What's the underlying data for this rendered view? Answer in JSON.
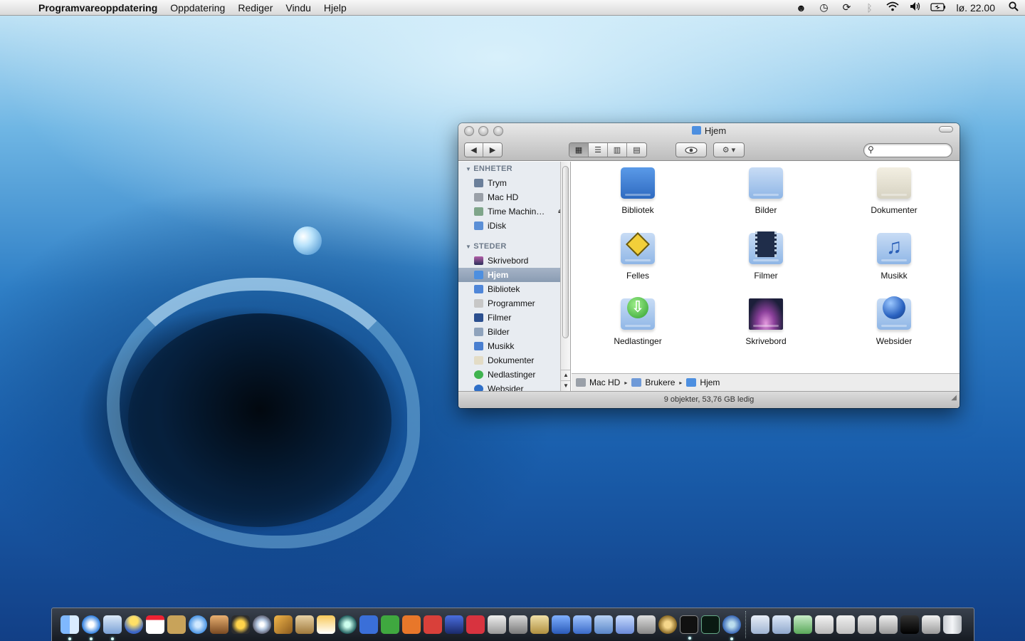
{
  "menubar": {
    "app_name": "Programvareoppdatering",
    "menus": [
      "Oppdatering",
      "Rediger",
      "Vindu",
      "Hjelp"
    ],
    "clock": "lø. 22.00"
  },
  "window": {
    "title": "Hjem",
    "search_placeholder": "",
    "sidebar": {
      "devices_heading": "ENHETER",
      "devices": [
        "Trym",
        "Mac HD",
        "Time Machin…",
        "iDisk"
      ],
      "places_heading": "STEDER",
      "places": [
        "Skrivebord",
        "Hjem",
        "Bibliotek",
        "Programmer",
        "Filmer",
        "Bilder",
        "Musikk",
        "Dokumenter",
        "Nedlastinger",
        "Websider"
      ],
      "selected": "Hjem"
    },
    "items": [
      "Bibliotek",
      "Bilder",
      "Dokumenter",
      "Felles",
      "Filmer",
      "Musikk",
      "Nedlastinger",
      "Skrivebord",
      "Websider"
    ],
    "path": [
      "Mac HD",
      "Brukere",
      "Hjem"
    ],
    "status": "9 objekter, 53,76 GB ledig"
  },
  "colors": {
    "folder_blue": "#8fb6e6",
    "selection": "#8a9cb3"
  }
}
